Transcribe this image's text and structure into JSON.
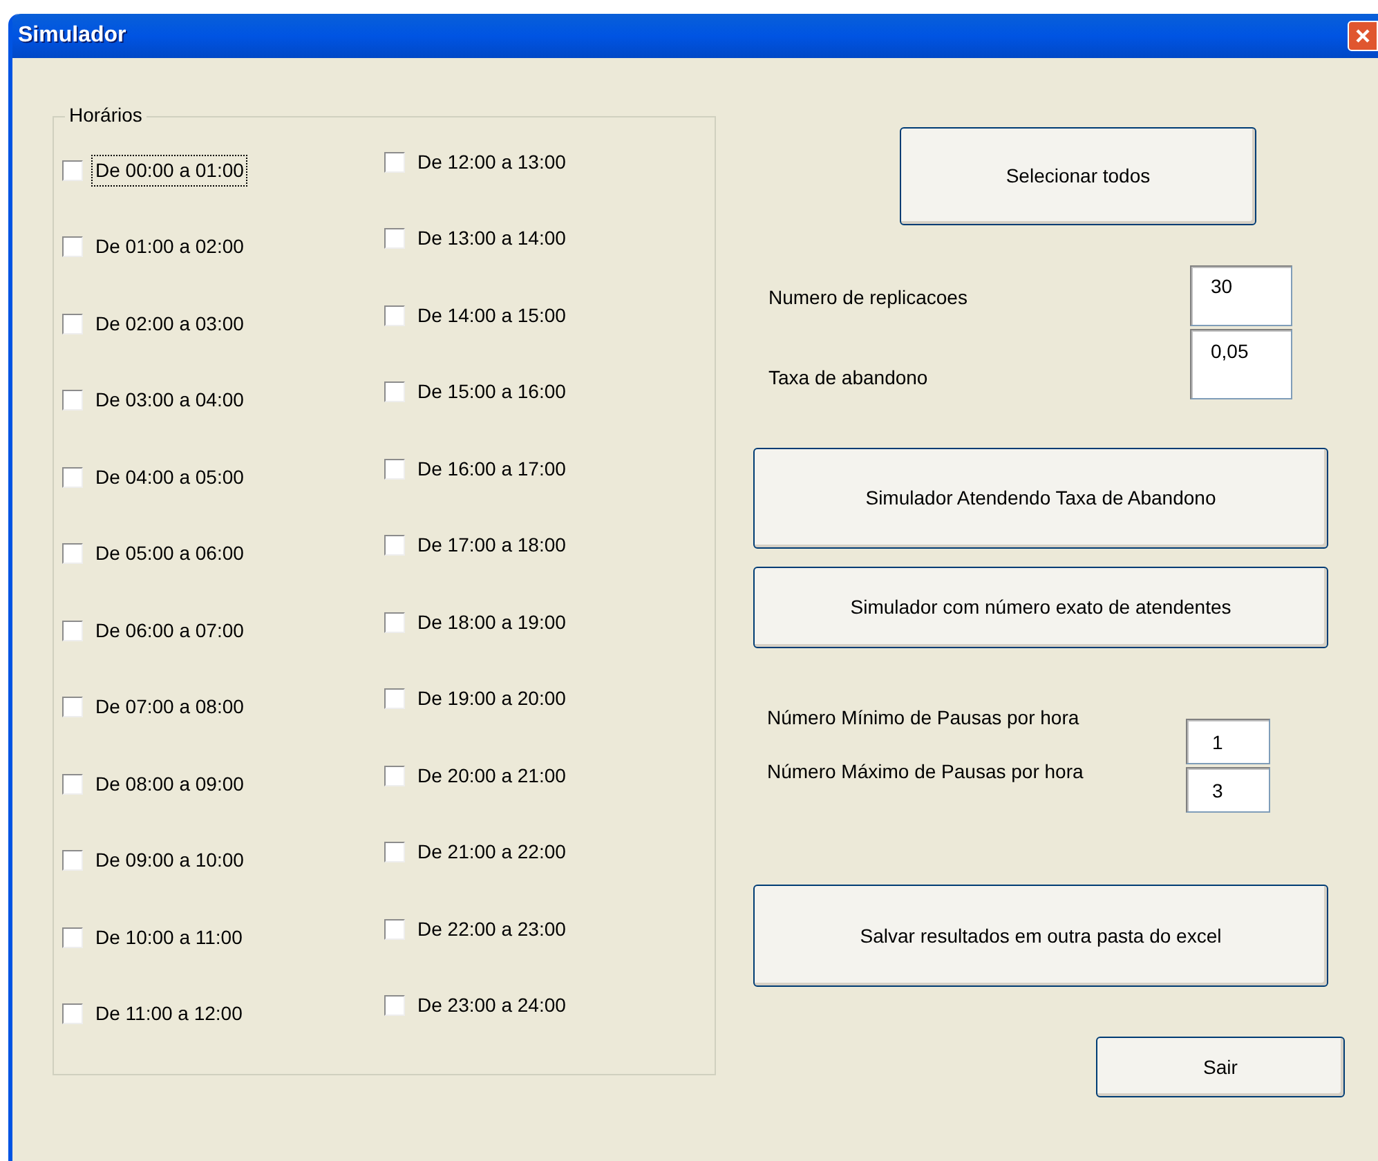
{
  "window": {
    "title": "Simulador"
  },
  "group": {
    "title": "Horários",
    "items": [
      {
        "label": "De 00:00 a 01:00",
        "checked": false,
        "focused": true
      },
      {
        "label": "De 01:00 a 02:00",
        "checked": false,
        "focused": false
      },
      {
        "label": "De 02:00 a 03:00",
        "checked": false,
        "focused": false
      },
      {
        "label": "De 03:00 a 04:00",
        "checked": false,
        "focused": false
      },
      {
        "label": "De 04:00 a 05:00",
        "checked": false,
        "focused": false
      },
      {
        "label": "De 05:00 a 06:00",
        "checked": false,
        "focused": false
      },
      {
        "label": "De 06:00 a 07:00",
        "checked": false,
        "focused": false
      },
      {
        "label": "De 07:00 a 08:00",
        "checked": false,
        "focused": false
      },
      {
        "label": "De 08:00 a 09:00",
        "checked": false,
        "focused": false
      },
      {
        "label": "De 09:00 a 10:00",
        "checked": false,
        "focused": false
      },
      {
        "label": "De 10:00 a 11:00",
        "checked": false,
        "focused": false
      },
      {
        "label": "De 11:00 a 12:00",
        "checked": false,
        "focused": false
      },
      {
        "label": "De 12:00 a 13:00",
        "checked": false,
        "focused": false
      },
      {
        "label": "De 13:00 a 14:00",
        "checked": false,
        "focused": false
      },
      {
        "label": "De 14:00 a 15:00",
        "checked": false,
        "focused": false
      },
      {
        "label": "De 15:00 a 16:00",
        "checked": false,
        "focused": false
      },
      {
        "label": "De 16:00 a 17:00",
        "checked": false,
        "focused": false
      },
      {
        "label": "De 17:00 a 18:00",
        "checked": false,
        "focused": false
      },
      {
        "label": "De 18:00 a 19:00",
        "checked": false,
        "focused": false
      },
      {
        "label": "De 19:00 a 20:00",
        "checked": false,
        "focused": false
      },
      {
        "label": "De 20:00 a 21:00",
        "checked": false,
        "focused": false
      },
      {
        "label": "De 21:00 a 22:00",
        "checked": false,
        "focused": false
      },
      {
        "label": "De 22:00 a 23:00",
        "checked": false,
        "focused": false
      },
      {
        "label": "De 23:00 a 24:00",
        "checked": false,
        "focused": false
      }
    ]
  },
  "select_all_button": "Selecionar todos",
  "replications": {
    "label": "Numero de replicacoes",
    "value": "30"
  },
  "abandon_rate": {
    "label": "Taxa de abandono",
    "value": "0,05"
  },
  "simulate_rate_button": "Simulador Atendendo Taxa de Abandono",
  "simulate_exact_button": "Simulador com número exato de atendentes",
  "min_pauses": {
    "label": "Número Mínimo de Pausas por hora",
    "value": "1"
  },
  "max_pauses": {
    "label": "Número Máximo de Pausas por hora",
    "value": "3"
  },
  "save_button": "Salvar resultados em outra pasta do excel",
  "exit_button": "Sair"
}
